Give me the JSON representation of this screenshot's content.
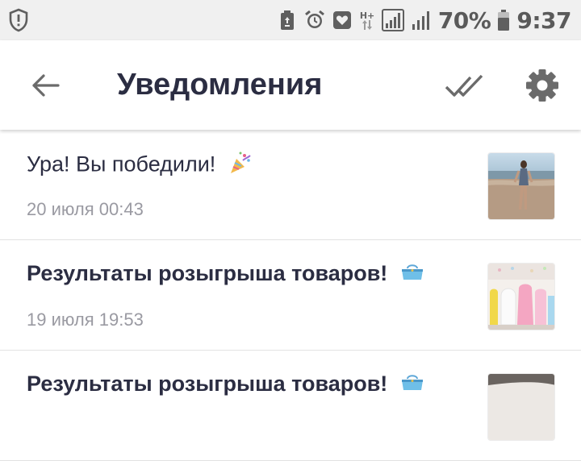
{
  "status_bar": {
    "battery_percent": "70%",
    "time": "9:37",
    "network_label": "H+",
    "icons": [
      "shield-alert-icon",
      "battery-saver-icon",
      "alarm-icon",
      "heart-app-icon",
      "data-arrows-icon",
      "signal-icon",
      "signal-icon-2",
      "battery-icon"
    ]
  },
  "app_bar": {
    "title": "Уведомления",
    "back_icon": "arrow-back-icon",
    "mark_all_icon": "double-check-icon",
    "settings_icon": "gear-icon"
  },
  "notifications": [
    {
      "title": "Ура! Вы победили!",
      "emoji_icon": "party-popper-icon",
      "time": "20 июля 00:43",
      "bold": false,
      "thumbnail": "beach-photo"
    },
    {
      "title": "Результаты розыгрыша товаров!",
      "emoji_icon": "purse-icon",
      "time": "19 июля 19:53",
      "bold": true,
      "thumbnail": "lamps-photo"
    },
    {
      "title": "Результаты розыгрыша товаров!",
      "emoji_icon": "purse-icon",
      "time": "",
      "bold": true,
      "thumbnail": "product-photo"
    }
  ],
  "colors": {
    "status_bar_bg": "#f0f0f0",
    "title_text": "#2b2d42",
    "secondary_text": "#9a9aa2",
    "icon_gray": "#6b6b6b"
  }
}
